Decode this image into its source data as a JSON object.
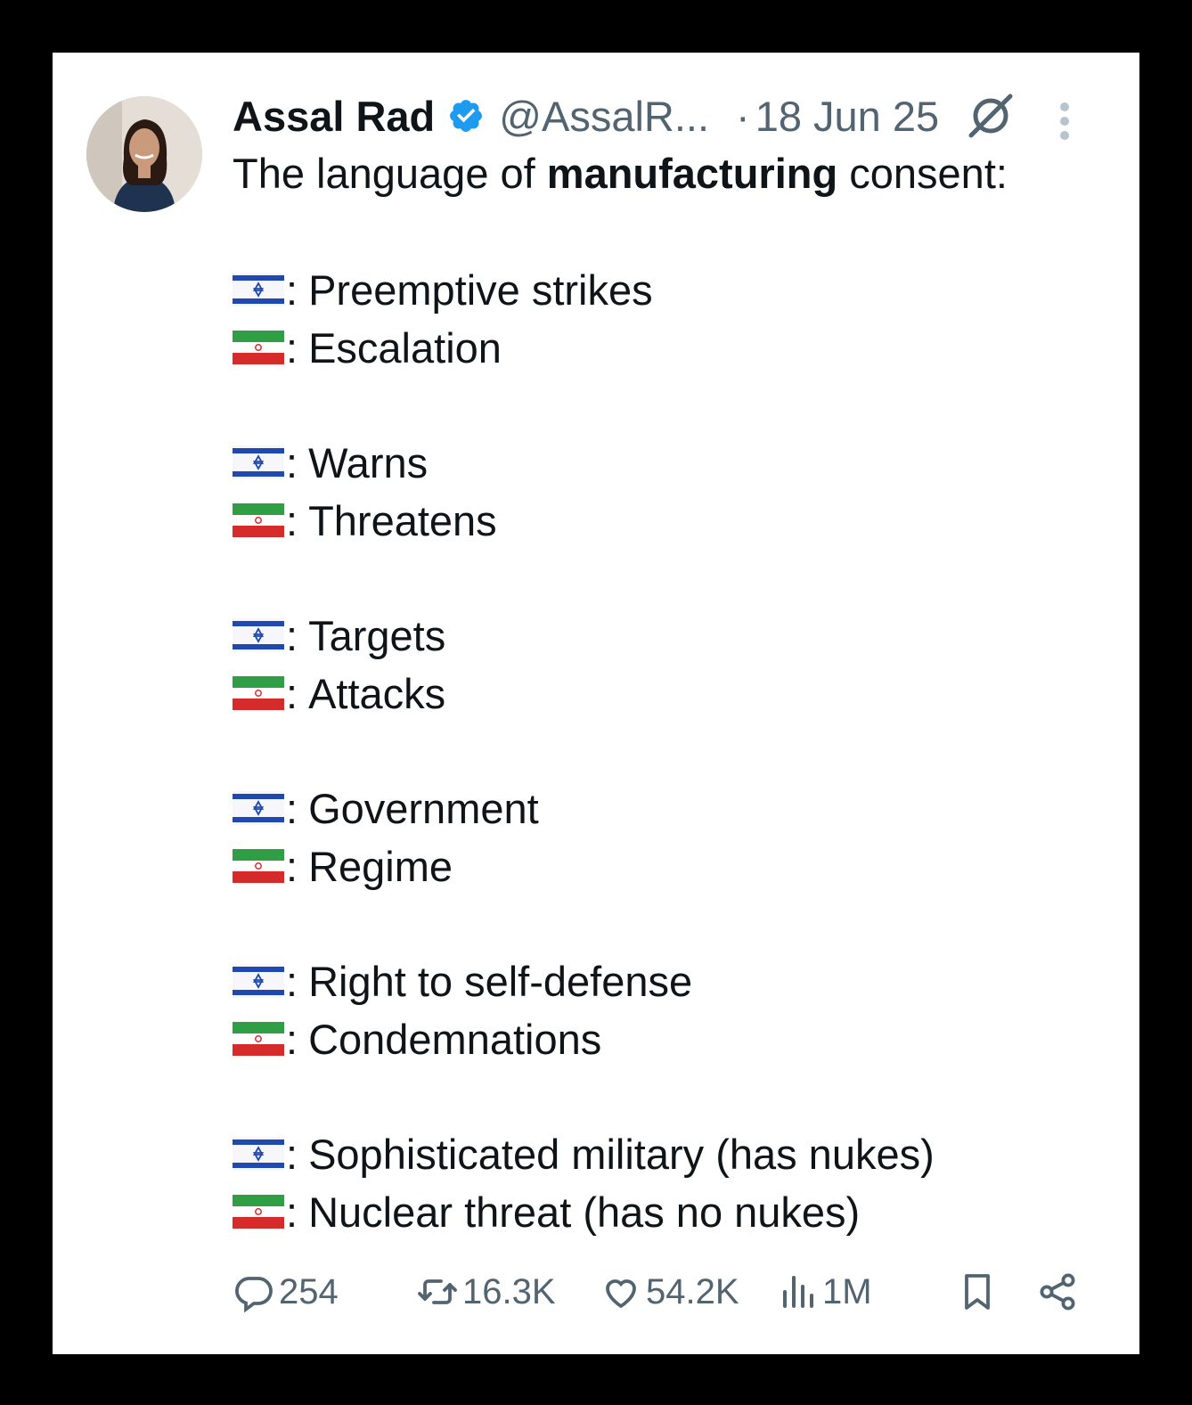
{
  "author": {
    "display_name": "Assal Rad",
    "handle": "@AssalR...",
    "date_separator": "·",
    "date": "18 Jun 25",
    "verified_badge_icon": "verified-badge-icon",
    "accent_color": "#1d9bf0"
  },
  "tweet": {
    "intro_before": "The language of ",
    "intro_bold": "manufacturing",
    "intro_after": " consent:",
    "pairs": [
      {
        "israel": "Preemptive strikes",
        "iran": "Escalation"
      },
      {
        "israel": "Warns",
        "iran": "Threatens"
      },
      {
        "israel": "Targets",
        "iran": "Attacks"
      },
      {
        "israel": "Government",
        "iran": "Regime"
      },
      {
        "israel": "Right to self-defense",
        "iran": "Condemnations"
      },
      {
        "israel": "Sophisticated military (has nukes)",
        "iran": "Nuclear threat (has no nukes)"
      }
    ],
    "separator": ":"
  },
  "actions": {
    "replies": "254",
    "reposts": "16.3K",
    "likes": "54.2K",
    "views": "1M"
  },
  "icons": [
    "grok-icon",
    "more-icon",
    "reply-icon",
    "repost-icon",
    "like-icon",
    "views-icon",
    "bookmark-icon",
    "share-icon",
    "israel-flag-icon",
    "iran-flag-icon"
  ]
}
